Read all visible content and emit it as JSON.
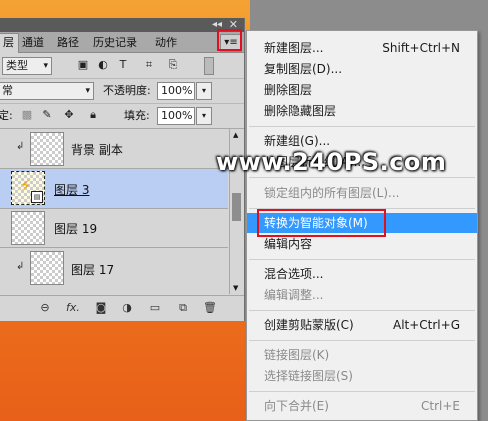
{
  "panel": {
    "tabs": [
      "层",
      "通道",
      "路径",
      "历史记录",
      "动作"
    ],
    "double_arrow": "◂◂",
    "close": "✕",
    "menu_icon": "▾≡",
    "filter_kind": "类型",
    "blend_mode": "常",
    "opacity_label": "不透明度:",
    "opacity_value": "100%",
    "lock_label": "定:",
    "fill_label": "填充:",
    "fill_value": "100%",
    "layers": [
      {
        "name": "背景 副本",
        "linked": true,
        "selected": false
      },
      {
        "name": "图层 3",
        "linked": false,
        "selected": true
      },
      {
        "name": "图层 19",
        "linked": false,
        "selected": false
      },
      {
        "name": "图层 17",
        "linked": true,
        "selected": false
      }
    ],
    "bottom_icons": [
      "link-icon",
      "fx-icon",
      "mask-icon",
      "adjustment-icon",
      "group-folder-icon",
      "new-layer-icon",
      "trash-icon"
    ],
    "bottom_fx": "fx."
  },
  "menu": {
    "items": [
      {
        "label": "新建图层...",
        "shortcut": "Shift+Ctrl+N",
        "disabled": false
      },
      {
        "label": "复制图层(D)...",
        "shortcut": "",
        "disabled": false
      },
      {
        "label": "删除图层",
        "shortcut": "",
        "disabled": false
      },
      {
        "label": "删除隐藏图层",
        "shortcut": "",
        "disabled": false
      },
      {
        "label": "新建组(G)...",
        "shortcut": "",
        "disabled": false
      },
      {
        "label": "从图层新建组(A)...",
        "shortcut": "",
        "disabled": false
      },
      {
        "label": "锁定组内的所有图层(L)...",
        "shortcut": "",
        "disabled": true
      },
      {
        "label": "转换为智能对象(M)",
        "shortcut": "",
        "disabled": false,
        "highlighted": true
      },
      {
        "label": "编辑内容",
        "shortcut": "",
        "disabled": false
      },
      {
        "label": "混合选项...",
        "shortcut": "",
        "disabled": false
      },
      {
        "label": "编辑调整...",
        "shortcut": "",
        "disabled": true
      },
      {
        "label": "创建剪贴蒙版(C)",
        "shortcut": "Alt+Ctrl+G",
        "disabled": false
      },
      {
        "label": "链接图层(K)",
        "shortcut": "",
        "disabled": true
      },
      {
        "label": "选择链接图层(S)",
        "shortcut": "",
        "disabled": true
      },
      {
        "label": "向下合并(E)",
        "shortcut": "Ctrl+E",
        "disabled": true
      }
    ]
  },
  "watermark": "www.240PS.com",
  "colors": {
    "highlight": "#3399ff",
    "annotation": "#e01020",
    "selected_layer": "#bacdf2"
  }
}
